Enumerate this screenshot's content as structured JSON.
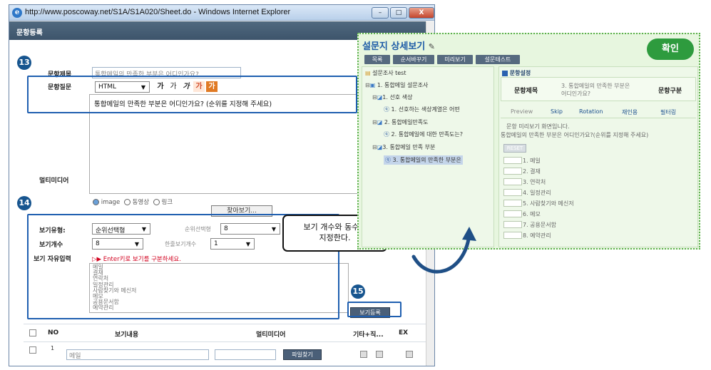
{
  "browser": {
    "title": "http://www.poscoway.net/S1A/S1A020/Sheet.do - Windows Internet Explorer",
    "min_label": "–",
    "max_label": "□",
    "close_label": "X"
  },
  "page": {
    "header_title": "문항등록"
  },
  "form": {
    "title_label": "문항제목",
    "title_value": "통합메일의 만족한 부분은 어디인가요?",
    "question_label": "문항질문",
    "format_select": "HTML",
    "format_buttons": [
      "가",
      "가",
      "가",
      "가",
      "가"
    ],
    "question_text": "통합메일의 만족한 부분은 어디인가요? (순위를 지정해 주세요)",
    "multimedia_label": "멀티미디어",
    "media_options": [
      "image",
      "동영상",
      "링크"
    ],
    "browse_button": "찾아보기...",
    "view_type_label": "보기유형:",
    "view_type_value": "순위선택형",
    "rank_select_label": "순위선택형",
    "rank_select_value": "8",
    "view_count_label": "보기개수",
    "view_count_value": "8",
    "per_row_label": "한줄보기개수",
    "per_row_value": "1",
    "free_input_label": "보기 자유입력",
    "free_input_hint": "▷▶ Enter키로 보기를 구분하세요.",
    "free_input_items": [
      "메일",
      "결재",
      "연락처",
      "일정관리",
      "사람찾기와 메신저",
      "메모",
      "공용문서함",
      "예약관리"
    ],
    "register_button": "보기등록"
  },
  "table": {
    "headers": [
      "NO",
      "보기내용",
      "멀티미디어",
      "기타+직...",
      "EX"
    ],
    "rows": [
      {
        "no": "1",
        "content": "메일",
        "file_button": "파일찾기"
      }
    ]
  },
  "steps": [
    "13",
    "14",
    "15"
  ],
  "callout": {
    "line1": "보기 개수와 동수로",
    "line2": "지정한다."
  },
  "detail_panel": {
    "title": "설문지 상세보기",
    "confirm_button": "확인",
    "tabs": [
      "목록",
      "순서바꾸기",
      "미리보기",
      "설문테스트"
    ],
    "tree": [
      "설문조사 test",
      "1. 통합메일 설문조사",
      "1. 선호 색상",
      "1. 선호하는 색상계열은 어떤",
      "2. 통합메일만족도",
      "2. 통합메일에 대한 만족도는?",
      "3. 통합메일 만족 부분",
      "3. 통합메일의 만족한 부분은"
    ],
    "settings_title": "문항설정",
    "col_title_label": "문항제목",
    "col_title_value": "3. 통합메일의 만족한 부분은 어디인가요?",
    "col_type_label": "문항구분",
    "preview_tabs": [
      "Preview",
      "Skip",
      "Rotation",
      "재인용",
      "필터링"
    ],
    "preview_note": "문항 미리보기 화면입니다.",
    "preview_question": "통합메일의 만족한 부분은 어디인가요?(순위를 지정해 주세요)",
    "reset_button": "RESET",
    "options": [
      "1. 메일",
      "2. 결재",
      "3. 연락처",
      "4. 일정관리",
      "5. 사람찾기와 메신저",
      "6. 메모",
      "7. 공용문서함",
      "8. 예약관리"
    ]
  }
}
